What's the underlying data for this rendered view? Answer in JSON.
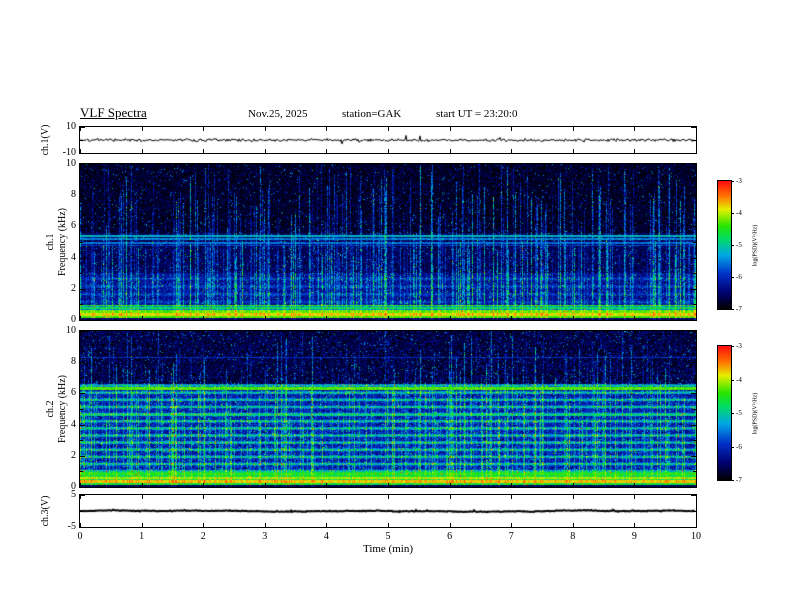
{
  "header": {
    "title": "VLF Spectra",
    "date": "Nov.25, 2025",
    "station": "station=GAK",
    "start_ut": "start UT =  23:20:0"
  },
  "axes": {
    "time": {
      "label": "Time (min)",
      "ticks": [
        0,
        1,
        2,
        3,
        4,
        5,
        6,
        7,
        8,
        9,
        10
      ],
      "range": [
        0,
        10
      ]
    },
    "left_labels": {
      "ch1v": "ch.1(V)",
      "spec1_line1": "ch.1",
      "spec1_line2": "Frequency (kHz)",
      "spec2_line1": "ch.2",
      "spec2_line2": "Frequency (kHz)",
      "ch3v": "ch.3(V)"
    }
  },
  "colorbar": {
    "label": "log(PSD)(V²/Hz)",
    "ticks": [
      -3,
      -4,
      -5,
      -6,
      -7
    ],
    "range": [
      -7,
      -3
    ],
    "gradient": [
      {
        "t": 0.0,
        "color": "#000004"
      },
      {
        "t": 0.12,
        "color": "#00006e"
      },
      {
        "t": 0.27,
        "color": "#0030c8"
      },
      {
        "t": 0.42,
        "color": "#00a8e6"
      },
      {
        "t": 0.55,
        "color": "#00dc64"
      },
      {
        "t": 0.65,
        "color": "#28e600"
      },
      {
        "t": 0.78,
        "color": "#e6f000"
      },
      {
        "t": 0.88,
        "color": "#ff7800"
      },
      {
        "t": 1.0,
        "color": "#ff0f0f"
      }
    ]
  },
  "chart_data": [
    {
      "id": "ch1_waveform",
      "type": "line",
      "ylabel": "ch.1(V)",
      "ylim": [
        -10,
        10
      ],
      "yticks": [
        10,
        -10
      ],
      "yticks_minor": [
        0
      ],
      "xlim": [
        0,
        10
      ],
      "description": "Raw ch.1 signal: dense noise band around 0 V, roughly ±1.5 V, occasional spikes to about ±4 V across the full 10 minute record",
      "render": {
        "seed": 7,
        "amplitude": 1.3,
        "spike_probability": 0.02,
        "spike_amplitude": 3.5,
        "line_width": 1
      }
    },
    {
      "id": "ch1_spectrogram",
      "type": "heatmap",
      "ylabel": "ch.1 Frequency (kHz)",
      "ylim": [
        0,
        10
      ],
      "yticks": [
        0,
        2,
        4,
        6,
        8,
        10
      ],
      "yticks_minor": [
        1,
        3,
        5,
        7,
        9
      ],
      "xlim": [
        0,
        10
      ],
      "value_range": [
        -7,
        -3
      ],
      "description": "VLF spectrogram ch.1: near-black background (about -6.8) above 5.6 kHz crossed by dense vertical sferic streaks, cyan horizontal lines near 4.8-5.4 kHz, brighter blue region 1-3 kHz, and an intense multicolour striped band below 1 kHz reaching about -3.5",
      "render": {
        "seed": 101,
        "noise": 0.7,
        "speckle_probability": 0.05,
        "speckle_strength": 1.6,
        "sferic_probability": 0.38,
        "sferic_min": 0.5,
        "sferic_max": 2.1,
        "base_levels": [
          {
            "f_min": 5.6,
            "f_max": 10.01,
            "psd": -6.85
          },
          {
            "f_min": 3.0,
            "f_max": 5.6,
            "psd": -6.6
          },
          {
            "f_min": 0.95,
            "f_max": 3.0,
            "psd": -6.3
          }
        ],
        "banding": {
          "f_min": 1.0,
          "f_max": 3.0,
          "period_khz": 0.5,
          "amplitude": 0.35,
          "phase": 0
        },
        "lines_khz": [
          {
            "f": 5.38,
            "w": 0.05,
            "psd": -5.2
          },
          {
            "f": 5.18,
            "w": 0.05,
            "psd": -5.5
          },
          {
            "f": 4.95,
            "w": 0.05,
            "psd": -5.6
          },
          {
            "f": 4.75,
            "w": 0.04,
            "psd": -5.9
          },
          {
            "f": 2.2,
            "w": 0.04,
            "psd": -6.1
          }
        ],
        "band": {
          "f_top": 0.95,
          "base": -5.5,
          "dark_below": 0.08,
          "blob_probability": 0.012,
          "stripes": [
            {
              "f": 0.16,
              "w": 0.06,
              "psd": -4.4
            },
            {
              "f": 0.32,
              "w": 0.07,
              "psd": -3.9
            },
            {
              "f": 0.52,
              "w": 0.07,
              "psd": -4.3
            },
            {
              "f": 0.72,
              "w": 0.06,
              "psd": -4.8
            },
            {
              "f": 0.9,
              "w": 0.05,
              "psd": -4.5
            }
          ]
        }
      }
    },
    {
      "id": "ch2_spectrogram",
      "type": "heatmap",
      "ylabel": "ch.2 Frequency (kHz)",
      "ylim": [
        0,
        10
      ],
      "yticks": [
        0,
        2,
        4,
        6,
        8,
        10
      ],
      "yticks_minor": [
        1,
        3,
        5,
        7,
        9
      ],
      "xlim": [
        0,
        10
      ],
      "value_range": [
        -7,
        -3
      ],
      "description": "VLF spectrogram ch.2: strong green/cyan horizontal banding every ~0.45 kHz between 1 and 6.6 kHz on a blue background, a bright green line at 6.3 kHz, dark streaked region above 6.6 kHz, and a bright yellow-green band below 1 kHz with a dark strip at the very bottom",
      "render": {
        "seed": 202,
        "noise": 0.8,
        "speckle_probability": 0.07,
        "speckle_strength": 1.5,
        "sferic_probability": 0.42,
        "sferic_min": 0.4,
        "sferic_max": 1.8,
        "base_levels": [
          {
            "f_min": 6.6,
            "f_max": 10.01,
            "psd": -6.7
          },
          {
            "f_min": 0.95,
            "f_max": 6.6,
            "psd": -6.15
          }
        ],
        "banding": {
          "f_min": 0.95,
          "f_max": 6.6,
          "period_khz": 0.46,
          "amplitude": 1.05,
          "phase": 0.6
        },
        "lines_khz": [
          {
            "f": 6.32,
            "w": 0.07,
            "psd": -4.3
          },
          {
            "f": 6.05,
            "w": 0.04,
            "psd": -5.4
          },
          {
            "f": 4.62,
            "w": 0.05,
            "psd": -5.0
          },
          {
            "f": 8.3,
            "w": 0.03,
            "psd": -6.0
          }
        ],
        "band": {
          "f_top": 0.95,
          "base": -4.7,
          "dark_below": 0.12,
          "blob_probability": 0.015,
          "stripes": [
            {
              "f": 0.3,
              "w": 0.09,
              "psd": -3.8
            },
            {
              "f": 0.55,
              "w": 0.08,
              "psd": -4.1
            },
            {
              "f": 0.8,
              "w": 0.06,
              "psd": -4.6
            }
          ]
        }
      }
    },
    {
      "id": "ch3_waveform",
      "type": "line",
      "ylabel": "ch.3(V)",
      "ylim": [
        -5,
        5
      ],
      "yticks": [
        5,
        -5
      ],
      "yticks_minor": [
        0
      ],
      "xlim": [
        0,
        10
      ],
      "xlabel": "Time (min)",
      "description": "Raw ch.3 signal: essentially a flat thick line at 0 V for the whole record",
      "render": {
        "seed": 9,
        "amplitude": 0.15,
        "spike_probability": 0.05,
        "spike_amplitude": 0.35,
        "line_width": 2
      }
    }
  ]
}
